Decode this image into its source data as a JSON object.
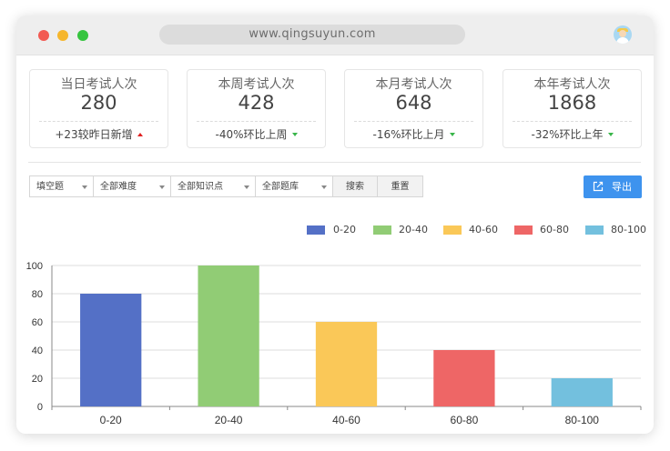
{
  "browser": {
    "url": "www.qingsuyun.com"
  },
  "stats": [
    {
      "title": "当日考试人次",
      "value": "280",
      "change": "+23较昨日新增",
      "trend": "up"
    },
    {
      "title": "本周考试人次",
      "value": "428",
      "change": "-40%环比上周",
      "trend": "down"
    },
    {
      "title": "本月考试人次",
      "value": "648",
      "change": "-16%环比上月",
      "trend": "down"
    },
    {
      "title": "本年考试人次",
      "value": "1868",
      "change": "-32%环比上年",
      "trend": "down"
    }
  ],
  "filters": {
    "type": "填空题",
    "difficulty": "全部难度",
    "knowledge": "全部知识点",
    "bank": "全部题库",
    "search_label": "搜索",
    "reset_label": "重置",
    "export_label": "导出"
  },
  "colors": {
    "accent": "#3e93ee",
    "up": "#e02020",
    "down": "#39b54a"
  },
  "chart_data": {
    "type": "bar",
    "categories": [
      "0-20",
      "20-40",
      "40-60",
      "60-80",
      "80-100"
    ],
    "values": [
      80,
      100,
      60,
      40,
      20
    ],
    "colors": [
      "#5470c6",
      "#91cc75",
      "#fac858",
      "#ee6666",
      "#73c0de"
    ],
    "legend": [
      "0-20",
      "20-40",
      "40-60",
      "60-80",
      "80-100"
    ],
    "legend_position": "top-right",
    "yticks": [
      0,
      20,
      40,
      60,
      80,
      100
    ],
    "ylim": [
      0,
      100
    ],
    "grid": true
  }
}
